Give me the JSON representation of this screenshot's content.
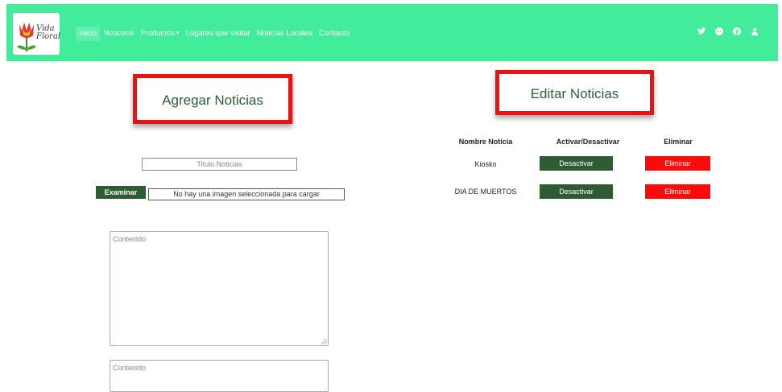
{
  "brand": {
    "logo_line1": "Vida",
    "logo_line2": "Floral"
  },
  "nav": {
    "items": [
      "Inicio",
      "Nosotros",
      "Productos",
      "Lugares que visitar",
      "Noticias Locales",
      "Contacto"
    ],
    "active_index": 0,
    "dropdown_caret": "▾",
    "social_icons": [
      "twitter-icon",
      "reddit-icon",
      "facebook-icon",
      "user-icon"
    ]
  },
  "add_section": {
    "title": "Agregar Noticias",
    "title_input_placeholder": "Titulo Noticias",
    "browse_label": "Examinar",
    "no_file_text": "No hay una imagen seleccionada para cargar",
    "content_placeholder": "Contenido",
    "content2_placeholder": "Contenido"
  },
  "edit_section": {
    "title": "Editar Noticias",
    "headers": [
      "Nombre Noticia",
      "Activar/Desactivar",
      "Eliminar"
    ],
    "rows": [
      {
        "name": "Kiosko",
        "toggle_label": "Desactivar",
        "delete_label": "Eliminar"
      },
      {
        "name": "DIA DE MUERTOS",
        "toggle_label": "Desactivar",
        "delete_label": "Eliminar"
      }
    ]
  },
  "colors": {
    "navbar": "#42ec9a",
    "primary_button": "#2f5b33",
    "danger_button": "#ff0a0a",
    "highlight_border": "#ee1111"
  }
}
